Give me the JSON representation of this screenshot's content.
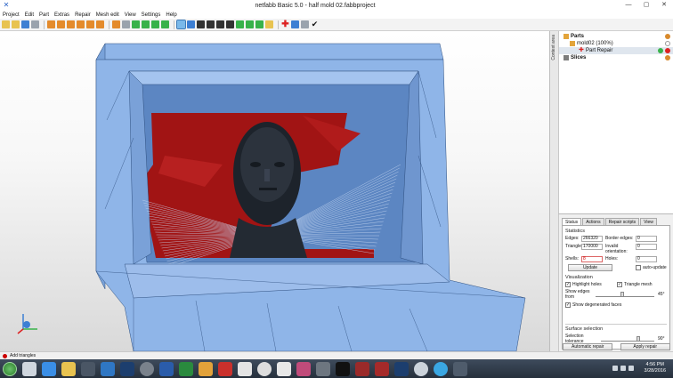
{
  "window": {
    "title": "netfabb Basic 5.0 - half mold 02.fabbproject"
  },
  "menu": [
    "Project",
    "Edit",
    "Part",
    "Extras",
    "Repair",
    "Mesh edit",
    "View",
    "Settings",
    "Help"
  ],
  "side_tab": {
    "label": "Context area"
  },
  "tree": {
    "parts_label": "Parts",
    "part_name": "mold02 (100%)",
    "repair_label": "Part Repair",
    "slices_label": "Slices"
  },
  "tabs": [
    "Status",
    "Actions",
    "Repair scripts",
    "View"
  ],
  "status": {
    "statistics_title": "Statistics",
    "edges_label": "Edges:",
    "edges_value": "266320",
    "triangles_label": "Triangles:",
    "triangles_value": "170000",
    "shells_label": "Shells:",
    "shells_value": "8",
    "border_edges_label": "Border edges:",
    "border_edges_value": "0",
    "invalid_orientation_label": "Invalid orientation:",
    "invalid_orientation_value": "0",
    "holes_label": "Holes:",
    "holes_value": "0",
    "update_button": "Update",
    "auto_update_label": "auto-update",
    "visualization_title": "Visualization",
    "highlight_holes_label": "Highlight holes",
    "triangle_mesh_label": "Triangle mesh",
    "show_edges_label": "Show edges from",
    "show_edges_value": "45°",
    "show_degenerated_label": "Show degenerated faces",
    "surface_selection_title": "Surface selection",
    "selection_tolerance_label": "Selection tolerance",
    "selection_tolerance_value": "90°",
    "show_edges_level": 0.45,
    "selection_tolerance_level": 0.7
  },
  "buttons": {
    "automatic_repair": "Automatic repair",
    "apply_repair": "Apply repair"
  },
  "statusbar": {
    "text": "Add triangles"
  },
  "clock": {
    "time": "4:56 PM",
    "date": "3/28/2016"
  },
  "colors": {
    "mold": "#8fb5e8",
    "mold_dark": "#6a94cc",
    "red_surface": "#a11414",
    "mesh_lines": "#2e4f7f"
  }
}
